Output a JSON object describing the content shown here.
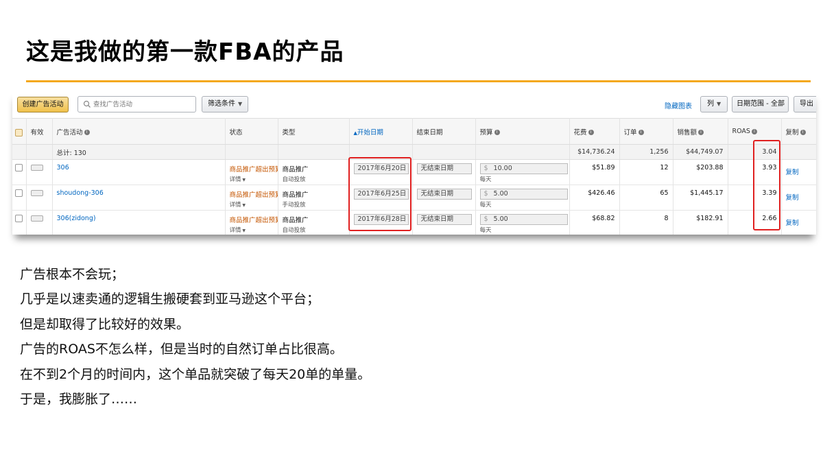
{
  "slide": {
    "title": "这是我做的第一款FBA的产品",
    "accent_color": "#f4a81d"
  },
  "toolbar": {
    "create_label": "创建广告活动",
    "search_placeholder": "查找广告活动",
    "search_icon": "search-icon",
    "filter_label": "筛选条件",
    "hide_chart_label": "隐藏图表",
    "columns_label": "列",
    "date_range_label": "日期范围 - 全部",
    "export_label": "导出"
  },
  "table": {
    "headers": {
      "active": "有效",
      "campaign": "广告活动",
      "status": "状态",
      "type": "类型",
      "start": "开始日期",
      "end": "结束日期",
      "budget": "预算",
      "spend": "花费",
      "orders": "订单",
      "sales": "销售额",
      "roas": "ROAS",
      "copy": "复制"
    },
    "total": {
      "label": "总计: 130",
      "spend": "$14,736.24",
      "orders": "1,256",
      "sales": "$44,749.07",
      "roas": "3.04"
    },
    "rows": [
      {
        "campaign": "306",
        "status": "商品推广超出预算",
        "status_sub": "详情",
        "type": "商品推广",
        "type_sub": "自动投放",
        "start": "2017年6月20日",
        "end": "无结束日期",
        "currency": "$",
        "budget": "10.00",
        "budget_unit": "每天",
        "spend": "$51.89",
        "orders": "12",
        "sales": "$203.88",
        "roas": "3.93",
        "copy": "复制"
      },
      {
        "campaign": "shoudong-306",
        "status": "商品推广超出预算",
        "status_sub": "详情",
        "type": "商品推广",
        "type_sub": "手动投放",
        "start": "2017年6月25日",
        "end": "无结束日期",
        "currency": "$",
        "budget": "5.00",
        "budget_unit": "每天",
        "spend": "$426.46",
        "orders": "65",
        "sales": "$1,445.17",
        "roas": "3.39",
        "copy": "复制"
      },
      {
        "campaign": "306(zidong)",
        "status": "商品推广超出预算",
        "status_sub": "详情",
        "type": "商品推广",
        "type_sub": "自动投放",
        "start": "2017年6月28日",
        "end": "无结束日期",
        "currency": "$",
        "budget": "5.00",
        "budget_unit": "每天",
        "spend": "$68.82",
        "orders": "8",
        "sales": "$182.91",
        "roas": "2.66",
        "copy": "复制"
      }
    ]
  },
  "notes": [
    "广告根本不会玩；",
    "几乎是以速卖通的逻辑生搬硬套到亚马逊这个平台；",
    "但是却取得了比较好的效果。",
    "广告的ROAS不怎么样，但是当时的自然订单占比很高。",
    "在不到2个月的时间内，这个单品就突破了每天20单的单量。",
    "于是，我膨胀了……"
  ]
}
